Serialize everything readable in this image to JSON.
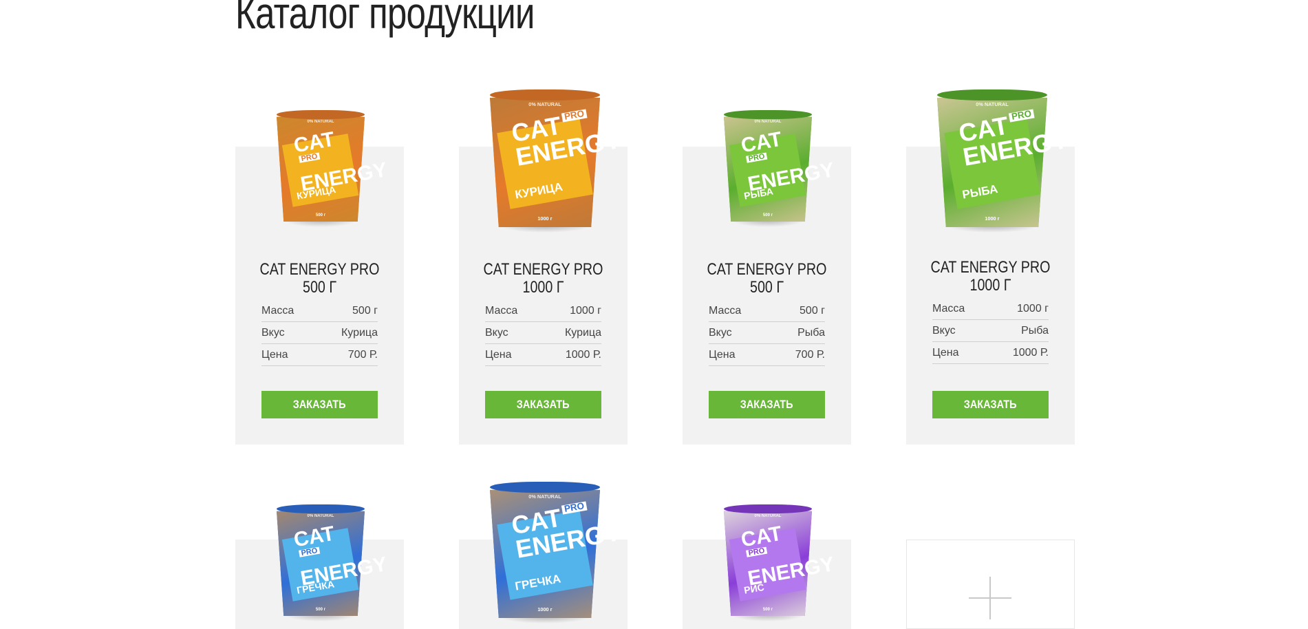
{
  "page": {
    "title": "Каталог продукции"
  },
  "catalog": {
    "row1": [
      {
        "title": "CAT ENERGY PRO 500 Г",
        "title_line1": "CAT ENERGY PRO",
        "title_line2": "500 Г",
        "specs": [
          {
            "label": "Масса",
            "value": "500 г"
          },
          {
            "label": "Вкус",
            "value": "Курица"
          },
          {
            "label": "Цена",
            "value": "700 Р."
          }
        ],
        "button": "ЗАКАЗАТЬ",
        "pack": {
          "brand_line1": "CAT",
          "brand_line2": "ENERGY",
          "pro": "PRO",
          "flavor": "КУРИЦА",
          "natural": "0% NATURAL",
          "weight": "500 г",
          "color": "#e57a2a",
          "band": "#f3b321",
          "texture": "#c9892e"
        }
      },
      {
        "title": "CAT ENERGY PRO 1000 Г",
        "title_line1": "CAT ENERGY PRO",
        "title_line2": "1000 Г",
        "specs": [
          {
            "label": "Масса",
            "value": "1000 г"
          },
          {
            "label": "Вкус",
            "value": "Курица"
          },
          {
            "label": "Цена",
            "value": "1000 Р."
          }
        ],
        "button": "ЗАКАЗАТЬ",
        "pack": {
          "brand_line1": "CAT",
          "brand_line2": "ENERGY",
          "pro": "PRO",
          "flavor": "КУРИЦА",
          "natural": "0% NATURAL",
          "weight": "1000 г",
          "color": "#e57a2a",
          "band": "#f3b321",
          "texture": "#b97a3a"
        }
      },
      {
        "title": "CAT ENERGY PRO 500 Г",
        "title_line1": "CAT ENERGY PRO",
        "title_line2": "500 Г",
        "specs": [
          {
            "label": "Масса",
            "value": "500 г"
          },
          {
            "label": "Вкус",
            "value": "Рыба"
          },
          {
            "label": "Цена",
            "value": "700 Р."
          }
        ],
        "button": "ЗАКАЗАТЬ",
        "pack": {
          "brand_line1": "CAT",
          "brand_line2": "ENERGY",
          "pro": "PRO",
          "flavor": "РЫБА",
          "natural": "0% NATURAL",
          "weight": "500 г",
          "color": "#5aae2e",
          "band": "#7cc63c",
          "texture": "#d7c59a"
        }
      },
      {
        "title": "CAT ENERGY PRO 1000 Г",
        "title_line1": "CAT ENERGY PRO",
        "title_line2": "1000 Г",
        "specs": [
          {
            "label": "Масса",
            "value": "1000 г"
          },
          {
            "label": "Вкус",
            "value": "Рыба"
          },
          {
            "label": "Цена",
            "value": "1000 Р."
          }
        ],
        "button": "ЗАКАЗАТЬ",
        "pack": {
          "brand_line1": "CAT",
          "brand_line2": "ENERGY",
          "pro": "PRO",
          "flavor": "РЫБА",
          "natural": "0% NATURAL",
          "weight": "1000 г",
          "color": "#5aae2e",
          "band": "#7cc63c",
          "texture": "#d8c8a0"
        }
      }
    ],
    "row2": [
      {
        "pack": {
          "brand_line1": "CAT",
          "brand_line2": "ENERGY",
          "pro": "PRO",
          "flavor": "ГРЕЧКА",
          "natural": "0% NATURAL",
          "weight": "500 г",
          "color": "#2f6fd8",
          "band": "#53b4ec",
          "texture": "#b08a64"
        }
      },
      {
        "pack": {
          "brand_line1": "CAT",
          "brand_line2": "ENERGY",
          "pro": "PRO",
          "flavor": "ГРЕЧКА",
          "natural": "0% NATURAL",
          "weight": "1000 г",
          "color": "#2f6fd8",
          "band": "#53b4ec",
          "texture": "#b8946c"
        }
      },
      {
        "pack": {
          "brand_line1": "CAT",
          "brand_line2": "ENERGY",
          "pro": "PRO",
          "flavor": "РИС",
          "natural": "0% NATURAL",
          "weight": "500 г",
          "color": "#8a3ed8",
          "band": "#b478ee",
          "texture": "#e6e2dc"
        }
      }
    ],
    "more_icon": "plus-icon"
  },
  "colors": {
    "accent": "#68b738",
    "card_bg": "#f2f2f2",
    "text": "#222222"
  }
}
